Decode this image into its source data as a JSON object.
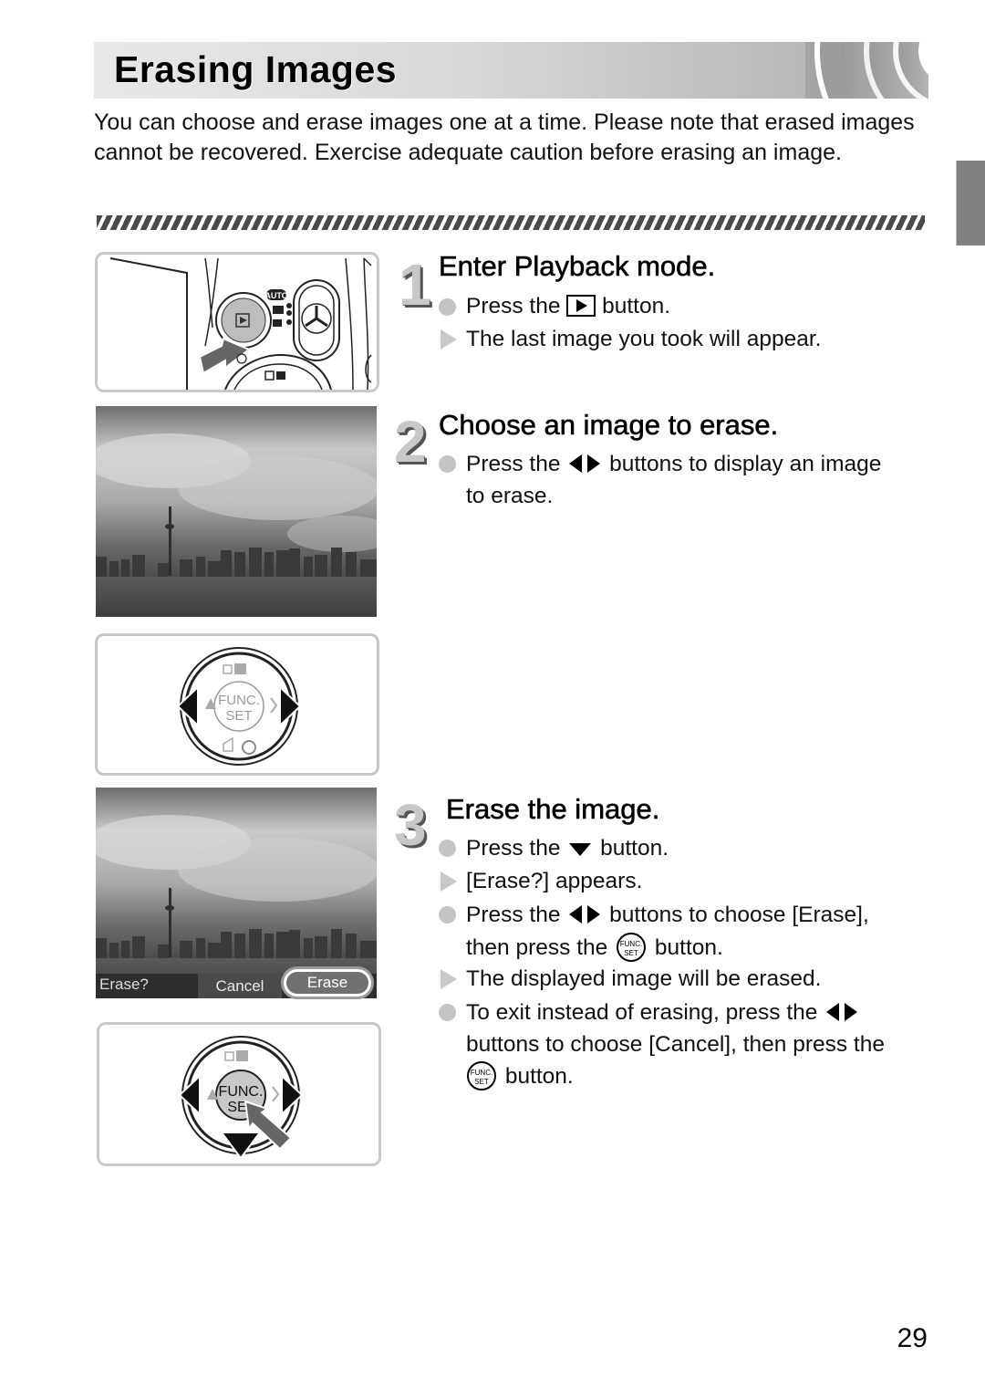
{
  "page": {
    "title": "Erasing Images",
    "intro": "You can choose and erase images one at a time. Please note that erased images cannot be recovered. Exercise adequate caution before erasing an image.",
    "page_number": "29"
  },
  "steps": [
    {
      "number": "1",
      "title": "Enter Playback mode.",
      "lines": [
        {
          "type": "action",
          "before": "Press the",
          "icon": "playback-button-icon",
          "after": "button."
        },
        {
          "type": "result",
          "text": "The last image you took will appear."
        }
      ],
      "illustration": {
        "labels": {
          "mode_auto": "AUTO"
        }
      }
    },
    {
      "number": "2",
      "title": "Choose an image to erase.",
      "lines": [
        {
          "type": "action",
          "before": "Press the",
          "icon": "left-right-buttons-icon",
          "after": "buttons to display an image",
          "cont": "to erase."
        }
      ],
      "illustration": {
        "func_label_1": "FUNC.",
        "func_label_2": "SET"
      }
    },
    {
      "number": "3",
      "title": "Erase the image.",
      "lines": [
        {
          "type": "action",
          "before": "Press the",
          "icon": "down-button-icon",
          "after": "button."
        },
        {
          "type": "result",
          "text": "[Erase?] appears."
        },
        {
          "type": "action",
          "before": "Press the",
          "icon": "left-right-buttons-icon",
          "after": "buttons to choose [Erase],",
          "cont_before": "then press the",
          "cont_icon": "func-set-button-icon",
          "cont_after": "button."
        },
        {
          "type": "result",
          "text": "The displayed image will be erased."
        },
        {
          "type": "action",
          "before": "To exit instead of erasing, press the",
          "icon": "left-right-buttons-icon",
          "after": "",
          "cont": "buttons to choose [Cancel], then press the",
          "cont2_icon": "func-set-button-icon",
          "cont2_after": "button."
        }
      ],
      "screen_overlay": {
        "prompt": "Erase?",
        "cancel": "Cancel",
        "erase": "Erase"
      },
      "illustration": {
        "func_label_1": "FUNC.",
        "func_label_2": "SE"
      }
    }
  ],
  "func_icon_text": {
    "top": "FUNC.",
    "bottom": "SET"
  }
}
